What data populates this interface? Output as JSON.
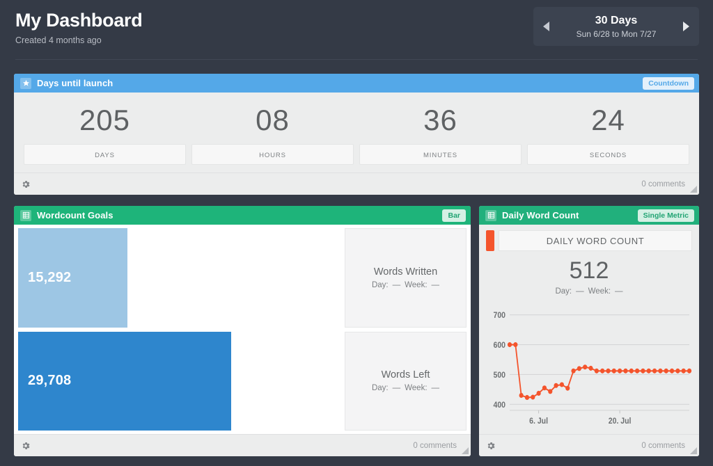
{
  "header": {
    "title": "My Dashboard",
    "subtitle": "Created 4 months ago",
    "date_range": {
      "label": "30 Days",
      "span": "Sun 6/28 to Mon 7/27",
      "prev_icon": "triangle-left-icon",
      "next_icon": "triangle-right-icon"
    }
  },
  "widgets": {
    "countdown": {
      "title": "Days until launch",
      "icon": "star-icon",
      "badge": "Countdown",
      "header_color": "#54a8e8",
      "segments": [
        {
          "value": "205",
          "label": "DAYS"
        },
        {
          "value": "08",
          "label": "HOURS"
        },
        {
          "value": "36",
          "label": "MINUTES"
        },
        {
          "value": "24",
          "label": "SECONDS"
        }
      ],
      "footer": {
        "settings_icon": "gear-icon",
        "comments": "0 comments"
      }
    },
    "wordcount_goals": {
      "title": "Wordcount Goals",
      "icon": "grid-icon",
      "badge": "Bar",
      "header_color": "#1eb47a",
      "footer": {
        "settings_icon": "gear-icon",
        "comments": "0 comments"
      }
    },
    "daily_word_count": {
      "title": "Daily Word Count",
      "icon": "grid-icon",
      "badge": "Single Metric",
      "header_color": "#21b07c",
      "metric_label": "DAILY WORD COUNT",
      "metric_value": "512",
      "metric_day_label": "Day:",
      "metric_day_value": "—",
      "metric_week_label": "Week:",
      "metric_week_value": "—",
      "swatch_color": "#f4542c",
      "footer": {
        "settings_icon": "gear-icon",
        "comments": "0 comments"
      }
    }
  },
  "chart_data": [
    {
      "type": "bar",
      "title": "Wordcount Goals",
      "orientation": "horizontal",
      "categories": [
        "Words Written",
        "Words Left"
      ],
      "values": [
        15292,
        29708
      ],
      "value_labels": [
        "15,292",
        "29,708"
      ],
      "colors": [
        "#9dc6e4",
        "#2e86cd"
      ],
      "xlim": [
        0,
        45000
      ],
      "grid": false,
      "legend": "right",
      "series_meta": [
        {
          "name": "Words Written",
          "day_label": "Day:",
          "day_value": "—",
          "week_label": "Week:",
          "week_value": "—"
        },
        {
          "name": "Words Left",
          "day_label": "Day:",
          "day_value": "—",
          "week_label": "Week:",
          "week_value": "—"
        }
      ]
    },
    {
      "type": "line",
      "title": "Daily Word Count",
      "xlabel": "",
      "ylabel": "",
      "ylim": [
        380,
        730
      ],
      "yticks": [
        400,
        500,
        600,
        700
      ],
      "ytick_labels": [
        "400",
        "500",
        "600",
        "700"
      ],
      "xticks": [
        5,
        19
      ],
      "xtick_labels": [
        "6. Jul",
        "20. Jul"
      ],
      "grid": true,
      "legend": "none",
      "color": "#f4542c",
      "marker": "circle",
      "series": [
        {
          "name": "Daily Word Count",
          "values": [
            600,
            600,
            430,
            423,
            424,
            437,
            455,
            443,
            463,
            466,
            454,
            512,
            520,
            525,
            521,
            512,
            512,
            512,
            512,
            512,
            512,
            512,
            512,
            512,
            512,
            512,
            512,
            512,
            512,
            512,
            512,
            512
          ]
        }
      ]
    }
  ]
}
